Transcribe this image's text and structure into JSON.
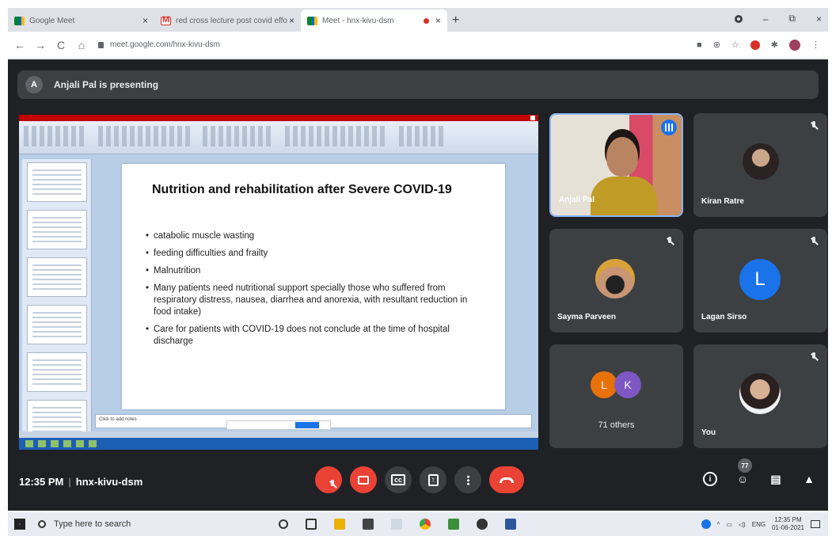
{
  "browser": {
    "tabs": [
      {
        "title": "Google Meet",
        "close": "×"
      },
      {
        "title": "red cross lecture post covid effo",
        "close": "×"
      },
      {
        "title": "Meet - hnx-kivu-dsm",
        "close": "×"
      }
    ],
    "new_tab": "+",
    "window_controls": {
      "minimize": "–",
      "restore": "⧉",
      "close": "×"
    },
    "nav": {
      "back": "←",
      "forward": "→",
      "reload": "C",
      "home": "⌂"
    },
    "url": "meet.google.com/hnx-kivu-dsm",
    "toolbar_icons": [
      "camera-icon",
      "zoom-icon",
      "star-icon",
      "extension-red-icon",
      "puzzle-icon",
      "profile-icon",
      "menu-icon"
    ],
    "star": "☆",
    "menu": "⋮"
  },
  "meet": {
    "presenter_initial": "A",
    "presenting_text": "Anjali Pal is presenting",
    "slide": {
      "title": "Nutrition and rehabilitation after Severe COVID-19",
      "bullets": [
        "catabolic muscle wasting",
        "feeding difficulties and frailty",
        "Malnutrition",
        "Many patients need nutritional support specially those who suffered from respiratory distress, nausea, diarrhea and anorexia, with resultant reduction in food intake)",
        "Care for patients with COVID-19 does not conclude at the time of hospital discharge"
      ],
      "notes_placeholder": "Click to add notes"
    },
    "participants": [
      {
        "name": "Anjali Pal"
      },
      {
        "name": "Kiran Ratre"
      },
      {
        "name": "Sayma Parveen"
      },
      {
        "name": "Lagan Sirso",
        "initial": "L"
      },
      {
        "name": "You"
      }
    ],
    "others": {
      "initials": [
        "L",
        "K"
      ],
      "label": "71 others"
    },
    "time": "12:35 PM",
    "separator": "|",
    "meeting_code": "hnx-kivu-dsm",
    "participant_count": "77",
    "controls": [
      "mic-off-button",
      "camera-off-button",
      "captions-button",
      "present-button",
      "more-options-button",
      "leave-call-button"
    ],
    "colors": {
      "stage": "#202124",
      "tile": "#3c4043",
      "danger": "#ea4335",
      "accent": "#1a73e8"
    }
  },
  "taskbar": {
    "search_placeholder": "Type here to search",
    "tray_lang": "ENG",
    "tray_time": "12:35 PM",
    "tray_date": "01-06-2021",
    "tray_chevron": "^"
  }
}
